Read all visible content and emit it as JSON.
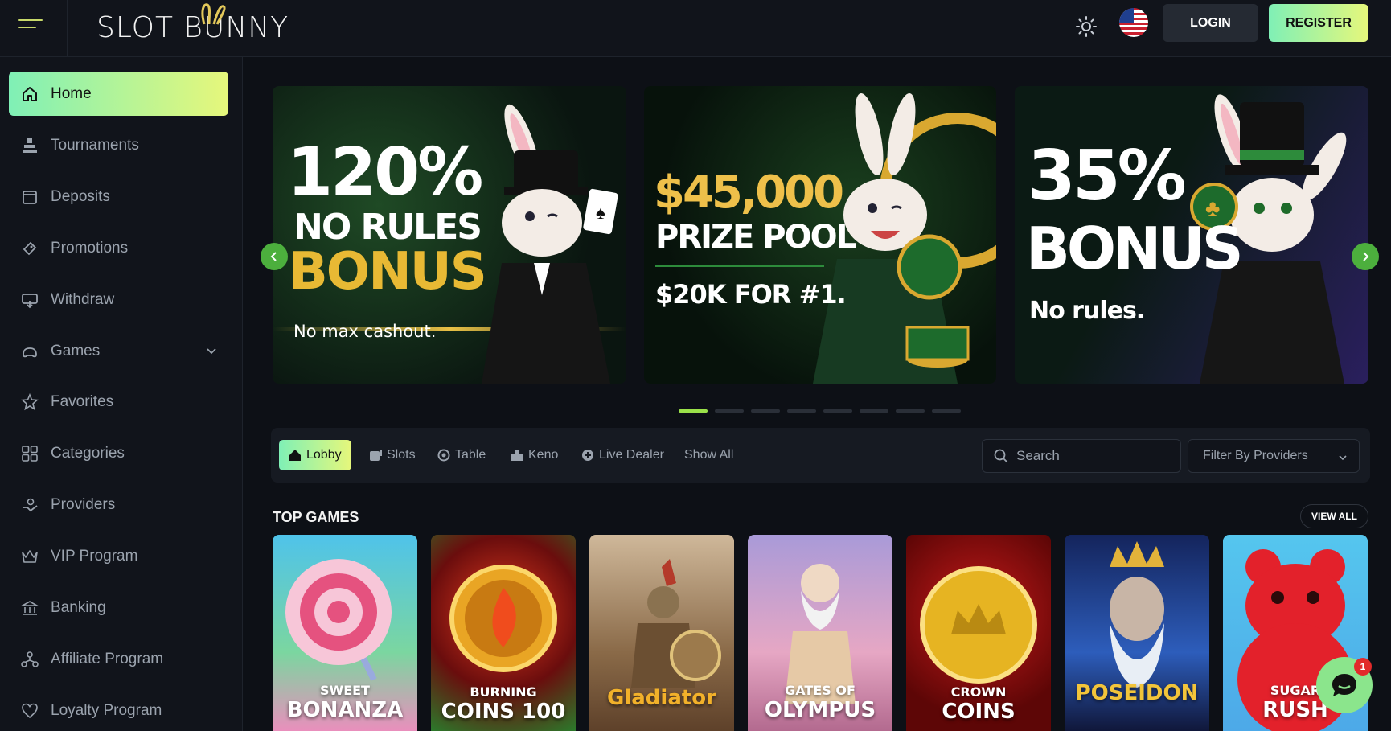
{
  "header": {
    "logo_text": "SLOT BUNNY",
    "login_label": "LOGIN",
    "register_label": "REGISTER",
    "icons": [
      "menu-icon",
      "sun-icon",
      "us-flag-icon"
    ]
  },
  "sidebar": {
    "items": [
      {
        "label": "Home",
        "icon": "home-icon",
        "active": true
      },
      {
        "label": "Tournaments",
        "icon": "trophy-icon"
      },
      {
        "label": "Deposits",
        "icon": "deposit-icon"
      },
      {
        "label": "Promotions",
        "icon": "promo-icon"
      },
      {
        "label": "Withdraw",
        "icon": "withdraw-icon"
      },
      {
        "label": "Games",
        "icon": "games-icon",
        "expandable": true
      },
      {
        "label": "Favorites",
        "icon": "star-icon"
      },
      {
        "label": "Categories",
        "icon": "grid-icon"
      },
      {
        "label": "Providers",
        "icon": "providers-icon"
      },
      {
        "label": "VIP Program",
        "icon": "crown-icon"
      },
      {
        "label": "Banking",
        "icon": "bank-icon"
      },
      {
        "label": "Affiliate Program",
        "icon": "affiliate-icon"
      },
      {
        "label": "Loyalty Program",
        "icon": "heart-icon"
      }
    ]
  },
  "banners": [
    {
      "big": "120%",
      "mid": "NO RULES",
      "accent": "BONUS",
      "sub": "No max cashout."
    },
    {
      "big": "$45,000",
      "mid": "PRIZE POOL",
      "sub": "$20K FOR #1."
    },
    {
      "big": "35%",
      "mid": "BONUS",
      "sub": "No rules."
    }
  ],
  "carousel": {
    "dot_count": 8,
    "active_index": 0
  },
  "tabs": [
    {
      "label": "Lobby",
      "icon": "lobby-icon",
      "active": true
    },
    {
      "label": "Slots",
      "icon": "slots-icon"
    },
    {
      "label": "Table",
      "icon": "table-icon"
    },
    {
      "label": "Keno",
      "icon": "keno-icon"
    },
    {
      "label": "Live Dealer",
      "icon": "live-dealer-icon"
    },
    {
      "label": "Show All"
    }
  ],
  "search": {
    "placeholder": "Search"
  },
  "provider_filter": {
    "label": "Filter By Providers"
  },
  "top_games": {
    "title": "TOP GAMES",
    "view_all_label": "VIEW ALL",
    "games": [
      {
        "line1": "SWEET",
        "line2": "BONANZA"
      },
      {
        "line1": "BURNING",
        "line2": "COINS 100"
      },
      {
        "line1": "",
        "line2": "Gladiator"
      },
      {
        "line1": "GATES OF",
        "line2": "OLYMPUS"
      },
      {
        "line1": "CROWN",
        "line2": "COINS"
      },
      {
        "line1": "",
        "line2": "POSEIDON"
      },
      {
        "line1": "SUGAR",
        "line2": "RUSH"
      }
    ]
  },
  "chat": {
    "badge_count": "1"
  },
  "colors": {
    "accent_start": "#7ff0b6",
    "accent_end": "#e6f77b",
    "background": "#0d1016",
    "panel": "#11141b",
    "carousel_arrow": "#4caf3d"
  }
}
